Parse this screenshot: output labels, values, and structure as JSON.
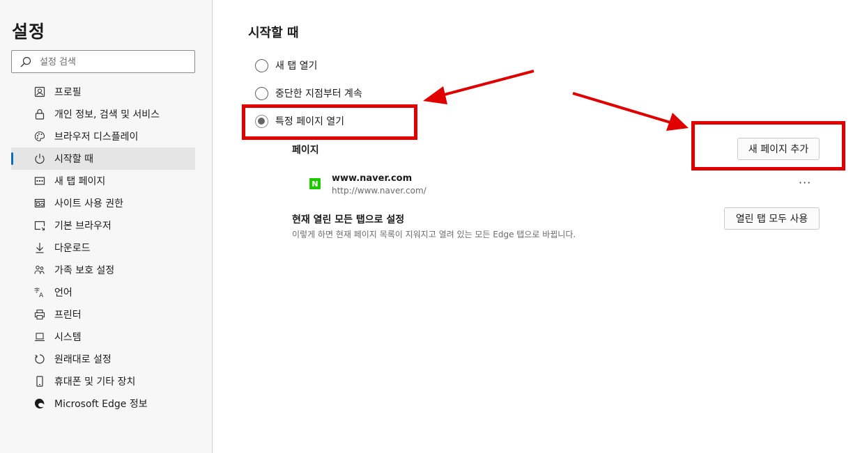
{
  "sidebar": {
    "title": "설정",
    "search_placeholder": "설정 검색",
    "items": [
      {
        "label": "프로필",
        "icon": "profile-icon"
      },
      {
        "label": "개인 정보, 검색 및 서비스",
        "icon": "lock-icon"
      },
      {
        "label": "브라우저 디스플레이",
        "icon": "palette-icon"
      },
      {
        "label": "시작할 때",
        "icon": "power-icon",
        "active": true
      },
      {
        "label": "새 탭 페이지",
        "icon": "new-tab-icon"
      },
      {
        "label": "사이트 사용 권한",
        "icon": "site-permissions-icon"
      },
      {
        "label": "기본 브라우저",
        "icon": "default-browser-icon"
      },
      {
        "label": "다운로드",
        "icon": "download-icon"
      },
      {
        "label": "가족 보호 설정",
        "icon": "family-icon"
      },
      {
        "label": "언어",
        "icon": "language-icon"
      },
      {
        "label": "프린터",
        "icon": "printer-icon"
      },
      {
        "label": "시스템",
        "icon": "laptop-icon"
      },
      {
        "label": "원래대로 설정",
        "icon": "reset-icon"
      },
      {
        "label": "휴대폰 및 기타 장치",
        "icon": "phone-icon"
      },
      {
        "label": "Microsoft Edge 정보",
        "icon": "edge-logo-icon"
      }
    ]
  },
  "main": {
    "section_title": "시작할 때",
    "options": [
      {
        "label": "새 탭 열기",
        "checked": false
      },
      {
        "label": "중단한 지점부터 계속",
        "checked": false
      },
      {
        "label": "특정 페이지 열기",
        "checked": true
      }
    ],
    "pages_label": "페이지",
    "add_page_button": "새 페이지 추가",
    "pages": [
      {
        "favicon_letter": "N",
        "name": "www.naver.com",
        "url": "http://www.naver.com/",
        "more": "···"
      }
    ],
    "use_all_tabs": {
      "title": "현재 열린 모든 탭으로 설정",
      "description": "이렇게 하면 현재 페이지 목록이 지워지고 열려 있는 모든 Edge 탭으로 바뀝니다.",
      "button": "열린 탭 모두 사용"
    }
  },
  "colors": {
    "annotation_red": "#e00000",
    "active_indicator": "#0f6cbd",
    "naver_green": "#1ec800"
  }
}
